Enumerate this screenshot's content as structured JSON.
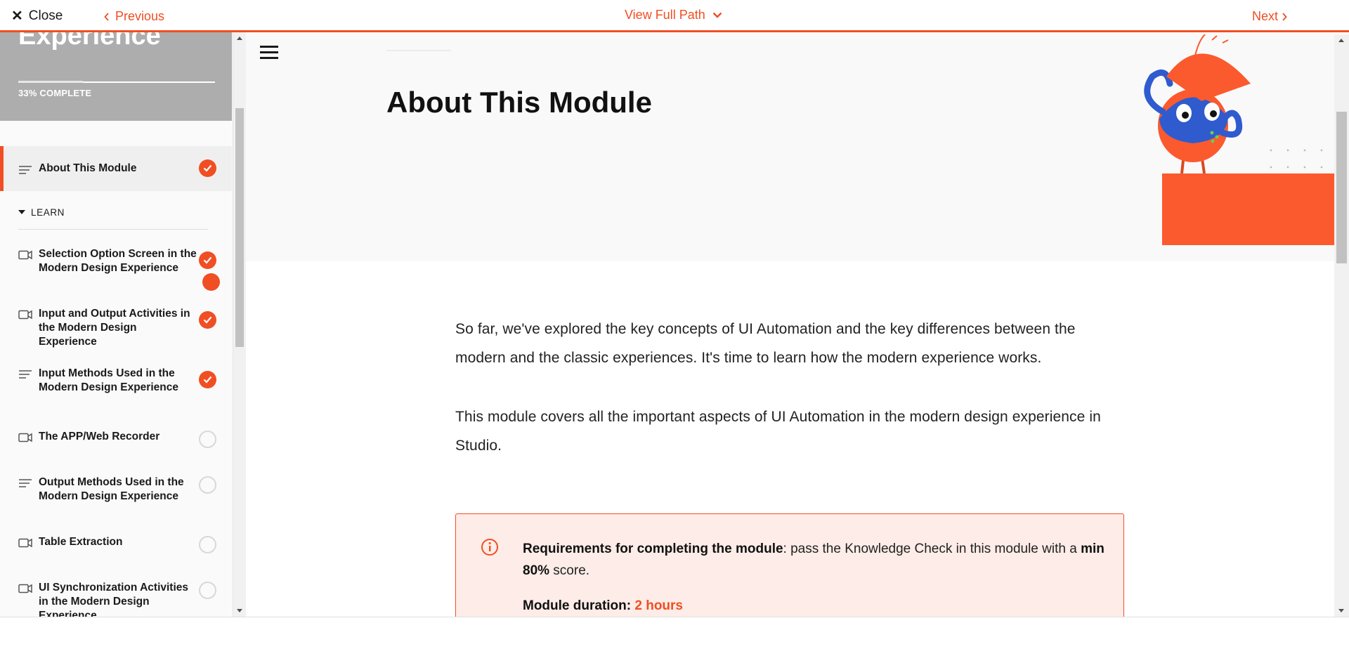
{
  "topbar": {
    "close_label": "Close",
    "previous_label": "Previous",
    "path_label": "View Full Path",
    "next_label": "Next"
  },
  "sidebar": {
    "course_title": "Experience",
    "progress_text": "33% COMPLETE",
    "progress_fraction": 0.33,
    "section_label": "LEARN",
    "items": [
      {
        "label": "About This Module",
        "icon": "text-lines-icon",
        "status": "complete"
      },
      {
        "label": "Selection Option Screen in the Modern Design Experience",
        "icon": "video-icon",
        "status": "complete"
      },
      {
        "label": "Input and Output Activities in the Modern Design Experience",
        "icon": "video-icon",
        "status": "complete"
      },
      {
        "label": "Input Methods Used in the Modern Design Experience",
        "icon": "text-lines-icon",
        "status": "complete"
      },
      {
        "label": "The APP/Web Recorder",
        "icon": "video-icon",
        "status": "incomplete"
      },
      {
        "label": "Output Methods Used in the Modern Design Experience",
        "icon": "text-lines-icon",
        "status": "incomplete"
      },
      {
        "label": "Table Extraction",
        "icon": "video-icon",
        "status": "incomplete"
      },
      {
        "label": "UI Synchronization Activities in the Modern Design Experience",
        "icon": "video-icon",
        "status": "incomplete"
      }
    ]
  },
  "main": {
    "title": "About This Module",
    "paragraph_1": "So far, we've explored the key concepts of UI Automation and the key differences between the modern and the classic experiences. It's time to learn how the modern experience works.",
    "paragraph_2": "This module covers all the important aspects of UI Automation in the modern design experience in Studio.",
    "callout": {
      "req_bold": "Requirements for completing the module",
      "req_text": ": pass the Knowledge Check in this module with a ",
      "req_min": "min 80%",
      "req_end": " score.",
      "duration_label": "Module duration:",
      "duration_value": "2 hours"
    }
  },
  "colors": {
    "accent": "#f04e23",
    "header_gray": "#adadad",
    "callout_bg": "#fdece7"
  }
}
